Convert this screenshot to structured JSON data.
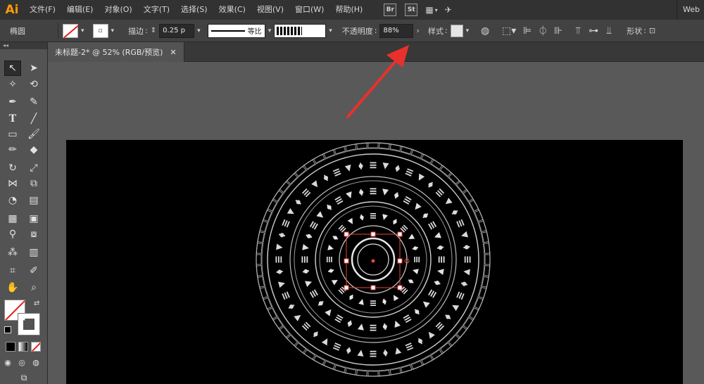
{
  "app": {
    "logo": "Ai",
    "workspace_label": "Web"
  },
  "menu": [
    "文件(F)",
    "编辑(E)",
    "对象(O)",
    "文字(T)",
    "选择(S)",
    "效果(C)",
    "视图(V)",
    "窗口(W)",
    "帮助(H)"
  ],
  "menu_badges": {
    "bridge": "Br",
    "stock": "St"
  },
  "control": {
    "object_type": "椭圆",
    "stroke_label": "描边",
    "stroke_weight": "0.25 p",
    "profile_label": "等比",
    "opacity_label": "不透明度",
    "opacity_value": "88%",
    "style_label": "样式",
    "shape_label": "形状"
  },
  "document": {
    "tab_title": "未标题-2* @ 52% (RGB/预览)",
    "close_glyph": "✕"
  },
  "colors": {
    "accent": "#ff9a00",
    "artboard": "#000000",
    "selection": "#e8453c",
    "arrow": "#e8312c"
  }
}
